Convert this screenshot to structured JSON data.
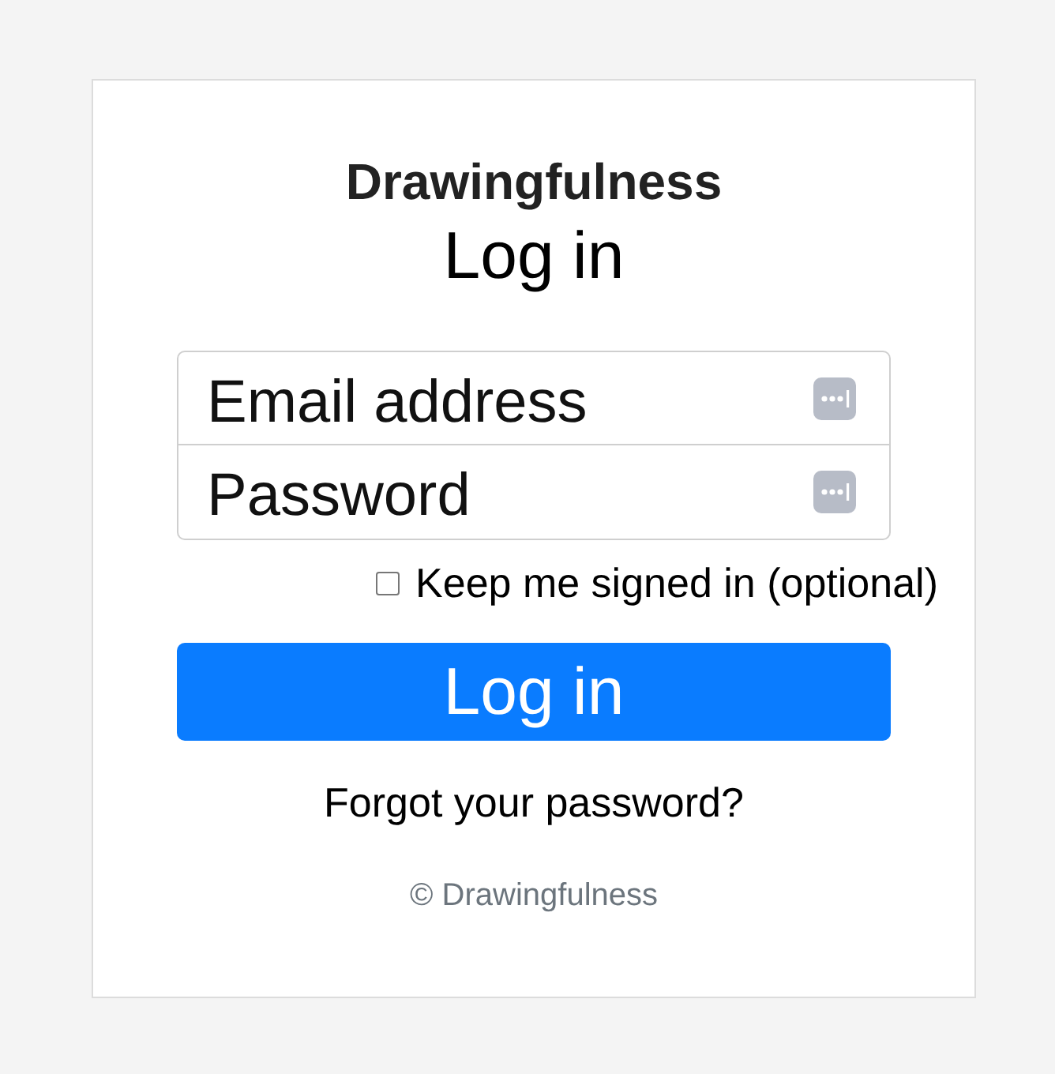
{
  "brand": "Drawingfulness",
  "heading": "Log in",
  "fields": [
    {
      "placeholder": "Email address"
    },
    {
      "placeholder": "Password"
    }
  ],
  "remember": {
    "label": "Keep me signed in (optional)",
    "checked": false
  },
  "submit": "Log in",
  "forgot_link": "Forgot your password?",
  "footer": "© Drawingfulness"
}
